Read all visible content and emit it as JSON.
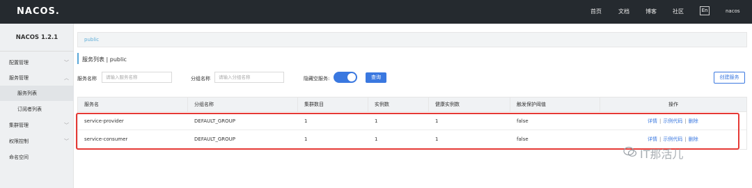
{
  "header": {
    "logo": "NACOS.",
    "nav": [
      "首页",
      "文档",
      "博客",
      "社区"
    ],
    "lang": "En",
    "user": "nacos"
  },
  "sidebar": {
    "version": "NACOS 1.2.1",
    "items": [
      {
        "label": "配置管理",
        "chevron": "﹀"
      },
      {
        "label": "服务管理",
        "chevron": "︿"
      },
      {
        "label": "服务列表"
      },
      {
        "label": "订阅者列表"
      },
      {
        "label": "集群管理",
        "chevron": "﹀"
      },
      {
        "label": "权限控制",
        "chevron": "﹀"
      },
      {
        "label": "命名空间"
      }
    ]
  },
  "breadcrumb": "public",
  "page_title": "服务列表 | public",
  "filters": {
    "service_name_label": "服务名称",
    "service_name_placeholder": "请输入服务名称",
    "group_name_label": "分组名称",
    "group_name_placeholder": "请输入分组名称",
    "hide_empty_label": "隐藏空服务:",
    "query_label": "查询",
    "create_label": "创建服务"
  },
  "table": {
    "columns": [
      "服务名",
      "分组名称",
      "集群数目",
      "实例数",
      "健康实例数",
      "触发保护阈值",
      "操作"
    ],
    "rows": [
      {
        "name": "service-provider",
        "group": "DEFAULT_GROUP",
        "clusters": "1",
        "instances": "1",
        "healthy": "1",
        "threshold": "false"
      },
      {
        "name": "service-consumer",
        "group": "DEFAULT_GROUP",
        "clusters": "1",
        "instances": "1",
        "healthy": "1",
        "threshold": "false"
      }
    ],
    "ops": {
      "detail": "详情",
      "sample": "示例代码",
      "delete": "删除",
      "sep": "|"
    }
  },
  "watermark": "IT那活儿",
  "colors": {
    "accent": "#3a78e0",
    "topbar": "#252a2f",
    "highlight": "#e53935"
  }
}
